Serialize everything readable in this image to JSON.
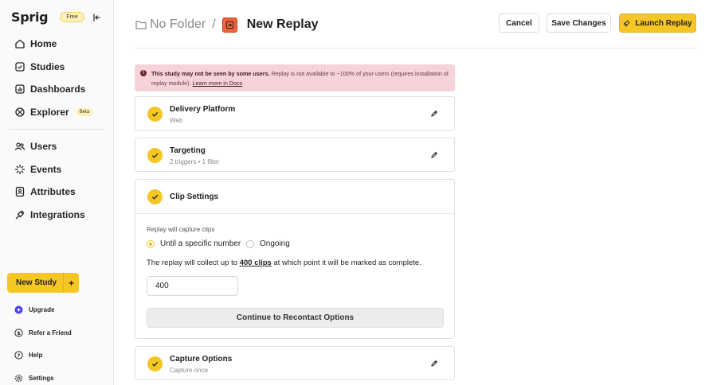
{
  "sidebar": {
    "logo": "Sprig",
    "plan_badge": "Free",
    "nav_primary": [
      {
        "label": "Home"
      },
      {
        "label": "Studies"
      },
      {
        "label": "Dashboards"
      },
      {
        "label": "Explorer",
        "badge": "Beta"
      }
    ],
    "nav_secondary": [
      {
        "label": "Users"
      },
      {
        "label": "Events"
      },
      {
        "label": "Attributes"
      },
      {
        "label": "Integrations"
      }
    ],
    "new_study": "New Study",
    "new_study_plus": "+",
    "footer": [
      {
        "label": "Upgrade"
      },
      {
        "label": "Refer a Friend"
      },
      {
        "label": "Help"
      },
      {
        "label": "Settings"
      }
    ]
  },
  "header": {
    "folder": "No Folder",
    "separator": "/",
    "title": "New Replay",
    "cancel": "Cancel",
    "save": "Save Changes",
    "launch": "Launch Replay"
  },
  "alert": {
    "bold": "This study may not be seen by some users.",
    "text": " Replay is not available to ~100% of your users (requires installation of replay module). ",
    "link": "Learn more in Docs"
  },
  "cards": {
    "delivery": {
      "title": "Delivery Platform",
      "sub": "Web"
    },
    "targeting": {
      "title": "Targeting",
      "sub": "2 triggers • 1 filter"
    },
    "clip": {
      "title": "Clip Settings",
      "intro": "Replay will capture clips",
      "option_specific": "Until a specific number",
      "option_ongoing": "Ongoing",
      "selected_option": "Until a specific number",
      "collect_pre": "The replay will collect up to ",
      "collect_value": "400 clips",
      "collect_post": " at which point it will be marked as complete.",
      "input_value": "400",
      "continue": "Continue to Recontact Options"
    },
    "capture": {
      "title": "Capture Options",
      "sub": "Capture once"
    }
  },
  "colors": {
    "accent": "#f6c624",
    "alert_bg": "#f5d3d9",
    "replay_icon": "#f0633a"
  }
}
